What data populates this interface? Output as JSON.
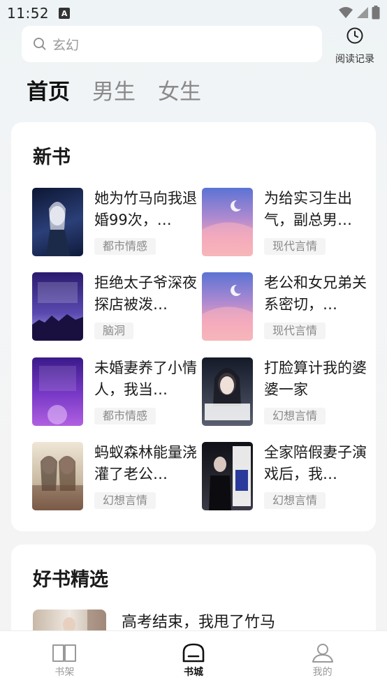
{
  "status_bar": {
    "time": "11:52",
    "notification_badge": "A"
  },
  "search": {
    "placeholder": "玄幻"
  },
  "header": {
    "history_label": "阅读记录"
  },
  "tabs": [
    {
      "label": "首页",
      "active": true
    },
    {
      "label": "男生",
      "active": false
    },
    {
      "label": "女生",
      "active": false
    }
  ],
  "new_books": {
    "title": "新书",
    "items": [
      {
        "title": "她为竹马向我退婚99次，…",
        "tag": "都市情感",
        "cover_colors": [
          "#0d1633",
          "#3a5a9a"
        ]
      },
      {
        "title": "为给实习生出气，副总男…",
        "tag": "现代言情",
        "cover_colors": [
          "#6a7fd6",
          "#f2a3b6"
        ]
      },
      {
        "title": "拒绝太子爷深夜探店被泼…",
        "tag": "脑洞",
        "cover_colors": [
          "#2a1a6e",
          "#7a6ad6"
        ]
      },
      {
        "title": "老公和女兄弟关系密切，…",
        "tag": "现代言情",
        "cover_colors": [
          "#6a7fd6",
          "#f2a3b6"
        ]
      },
      {
        "title": "未婚妻养了小情人，我当…",
        "tag": "都市情感",
        "cover_colors": [
          "#3a1a8a",
          "#a04adf"
        ]
      },
      {
        "title": "打脸算计我的婆婆一家",
        "tag": "幻想言情",
        "cover_colors": [
          "#1a2030",
          "#5a6070"
        ],
        "cover_text": "打脸算计我的婆婆一家"
      },
      {
        "title": "蚂蚁森林能量浇灌了老公…",
        "tag": "幻想言情",
        "cover_colors": [
          "#e8dcc8",
          "#6a4a3a"
        ]
      },
      {
        "title": "全家陪假妻子演戏后，我…",
        "tag": "幻想言情",
        "cover_colors": [
          "#101018",
          "#3a3a48"
        ]
      }
    ]
  },
  "picks": {
    "title": "好书精选",
    "items": [
      {
        "title": "高考结束，我甩了竹马"
      }
    ]
  },
  "bottom_nav": [
    {
      "label": "书架",
      "icon": "book-open-icon",
      "active": false
    },
    {
      "label": "书城",
      "icon": "store-icon",
      "active": true
    },
    {
      "label": "我的",
      "icon": "user-icon",
      "active": false
    }
  ]
}
